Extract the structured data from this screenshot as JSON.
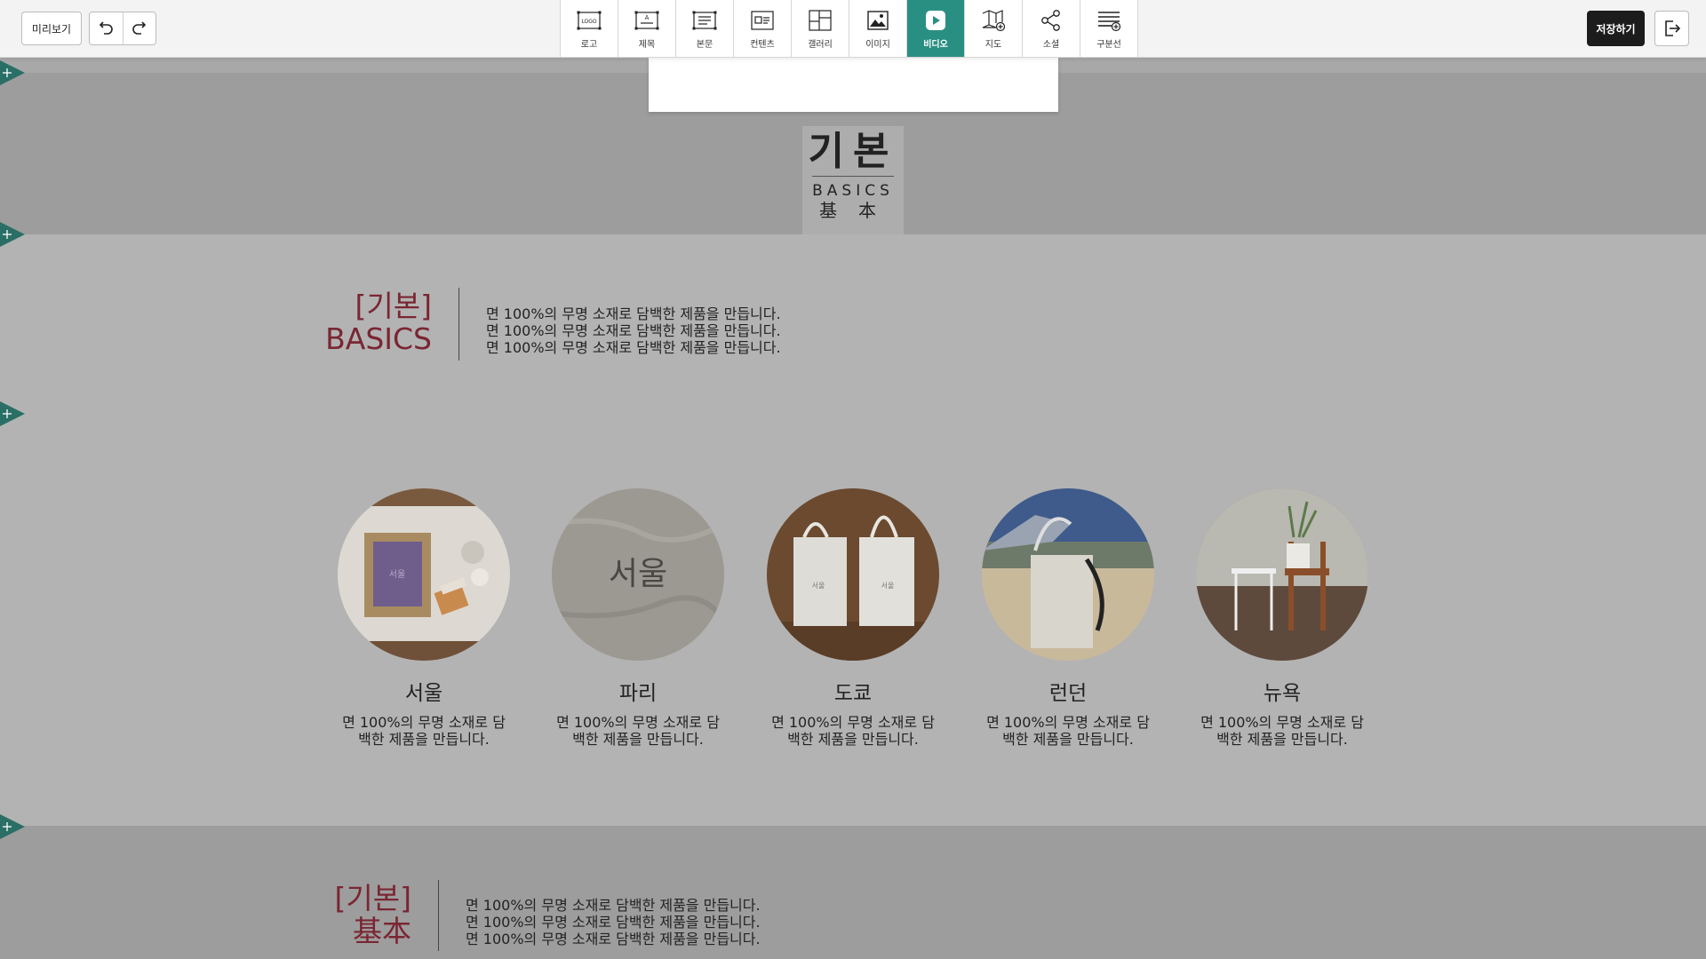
{
  "toolbar": {
    "preview_label": "미리보기",
    "save_label": "저장하기",
    "tools": [
      {
        "label": "로고",
        "icon": "logo-icon",
        "active": false
      },
      {
        "label": "제목",
        "icon": "title-icon",
        "active": false
      },
      {
        "label": "본문",
        "icon": "body-text-icon",
        "active": false
      },
      {
        "label": "컨텐츠",
        "icon": "content-icon",
        "active": false
      },
      {
        "label": "갤러리",
        "icon": "gallery-icon",
        "active": false
      },
      {
        "label": "이미지",
        "icon": "image-icon",
        "active": false
      },
      {
        "label": "비디오",
        "icon": "video-icon",
        "active": true
      },
      {
        "label": "지도",
        "icon": "map-icon",
        "active": false
      },
      {
        "label": "소셜",
        "icon": "share-icon",
        "active": false
      },
      {
        "label": "구분선",
        "icon": "divider-icon",
        "active": false
      }
    ]
  },
  "hero": {
    "logo_ko": "기본",
    "logo_en": "BASICS",
    "logo_cn": "基本"
  },
  "section_basic": {
    "heading1": "[기본]",
    "heading2": "BASICS",
    "lines": [
      "면 100%의 무명 소재로 담백한 제품을 만듭니다.",
      "면 100%의 무명 소재로 담백한 제품을 만듭니다.",
      "면 100%의 무명 소재로 담백한 제품을 만듭니다."
    ]
  },
  "cards": [
    {
      "title": "서울",
      "desc1": "면 100%의 무명 소재로 담",
      "desc2": "백한 제품을 만듭니다.",
      "photo": "stamp-and-frame-photo"
    },
    {
      "title": "파리",
      "desc1": "면 100%의 무명 소재로 담",
      "desc2": "백한 제품을 만듭니다.",
      "photo": "fabric-print-photo",
      "photo_text": "서울"
    },
    {
      "title": "도쿄",
      "desc1": "면 100%의 무명 소재로 담",
      "desc2": "백한 제품을 만듭니다.",
      "photo": "tote-bags-photo"
    },
    {
      "title": "런던",
      "desc1": "면 100%의 무명 소재로 담",
      "desc2": "백한 제품을 만듭니다.",
      "photo": "beach-bag-photo"
    },
    {
      "title": "뉴욕",
      "desc1": "면 100%의 무명 소재로 담",
      "desc2": "백한 제품을 만듭니다.",
      "photo": "chairs-interior-photo"
    }
  ],
  "section_foot": {
    "heading1": "[기본]",
    "heading2": "基本",
    "lines": [
      "면 100%의 무명 소재로 담백한 제품을 만듭니다.",
      "면 100%의 무명 소재로 담백한 제품을 만듭니다.",
      "면 100%의 무명 소재로 담백한 제품을 만듭니다."
    ]
  },
  "colors": {
    "accent": "#2a8f83",
    "heading": "#7a2632",
    "marker": "#2a6f66"
  }
}
